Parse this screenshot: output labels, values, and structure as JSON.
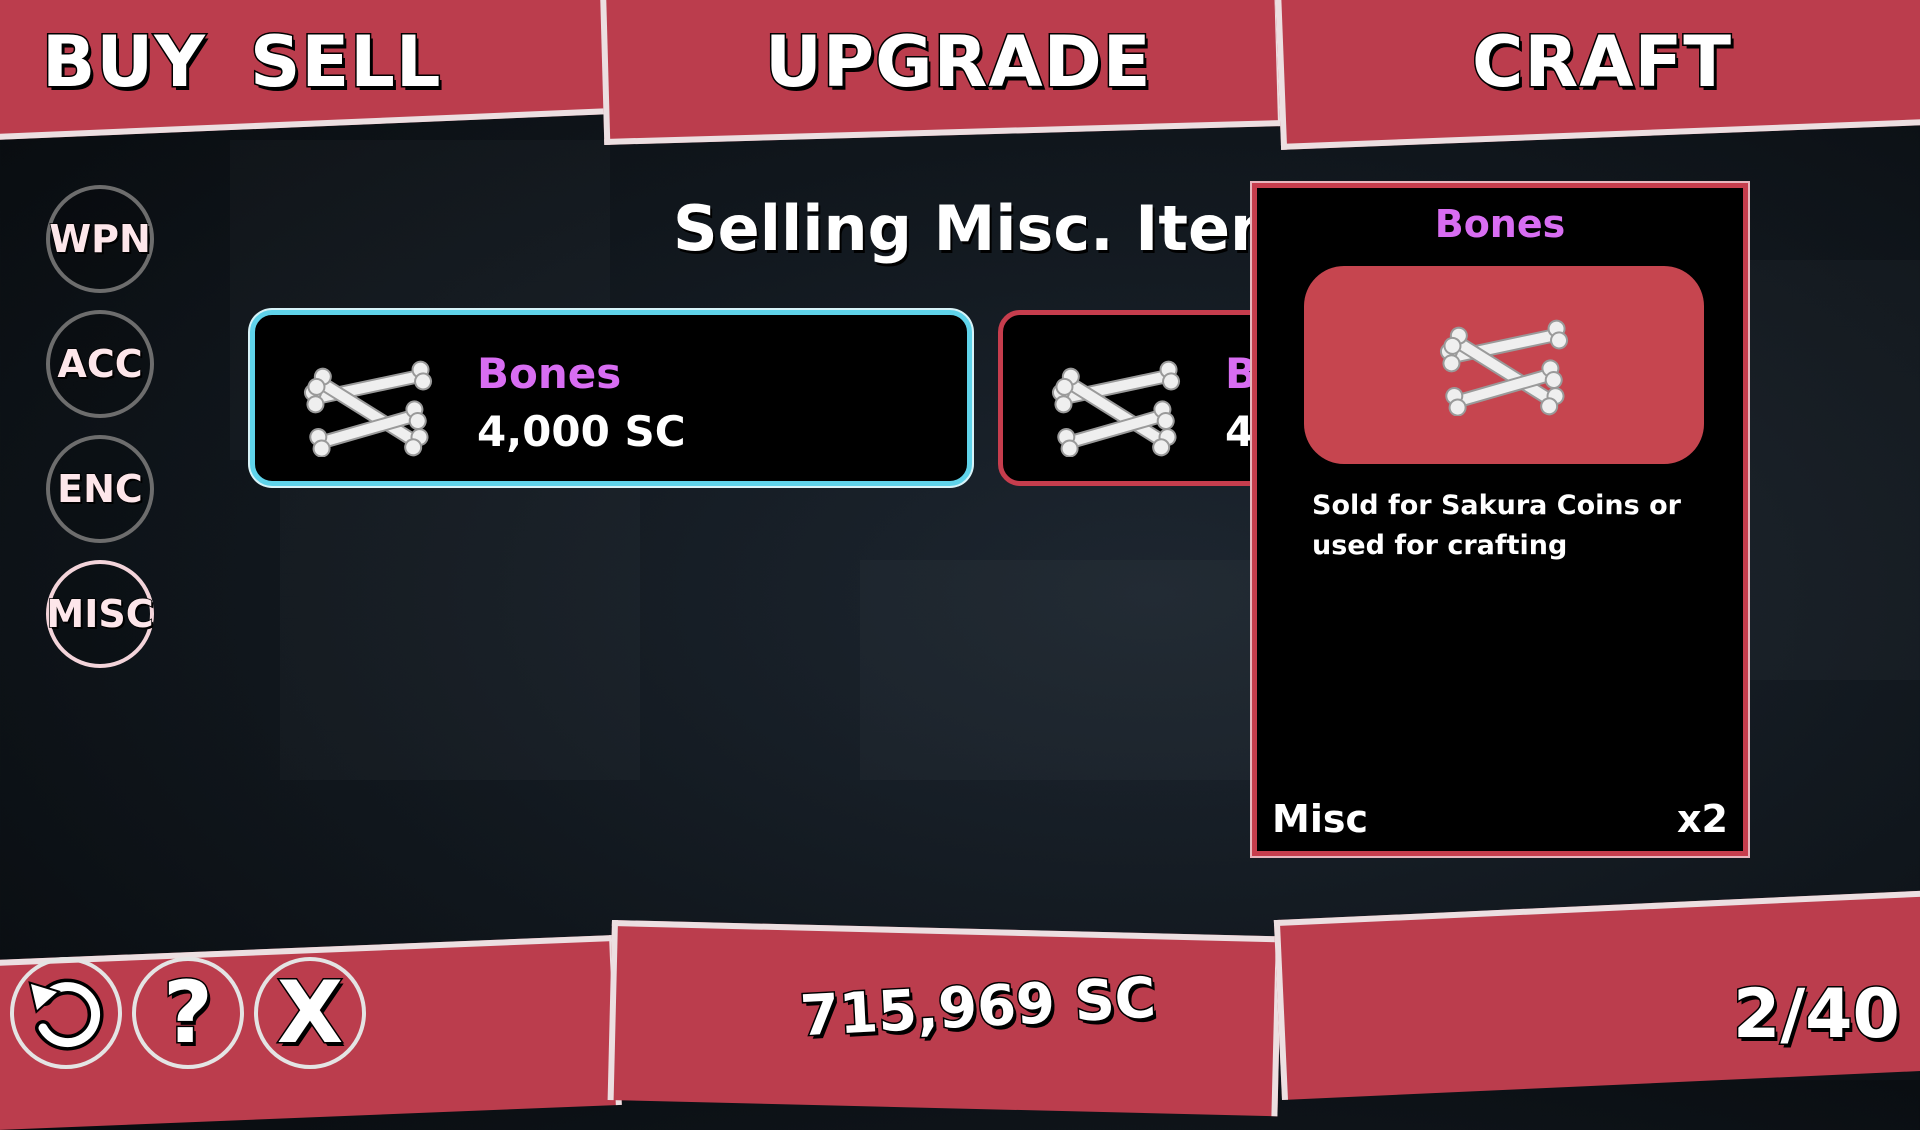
{
  "header": {
    "buy_label": "BUY",
    "sell_label": "SELL",
    "upgrade_label": "UPGRADE",
    "craft_label": "CRAFT"
  },
  "sidebar": {
    "items": [
      {
        "label": "WPN"
      },
      {
        "label": "ACC"
      },
      {
        "label": "ENC"
      },
      {
        "label": "MISC"
      }
    ]
  },
  "main": {
    "title": "Selling Misc. Item",
    "cards": [
      {
        "name": "Bones",
        "price": "4,000 SC"
      },
      {
        "name": "B",
        "price": "4,"
      }
    ]
  },
  "detail": {
    "name": "Bones",
    "description": "Sold for Sakura Coins or used for crafting",
    "category": "Misc",
    "quantity": "x2"
  },
  "footer": {
    "undo_icon": "undo-icon",
    "help_label": "?",
    "close_label": "X",
    "balance": "715,969 SC",
    "page": "2/40"
  },
  "colors": {
    "panel_red": "#bb3d4d",
    "selected_border": "#5fd3ea",
    "item_name": "#d86df2"
  }
}
